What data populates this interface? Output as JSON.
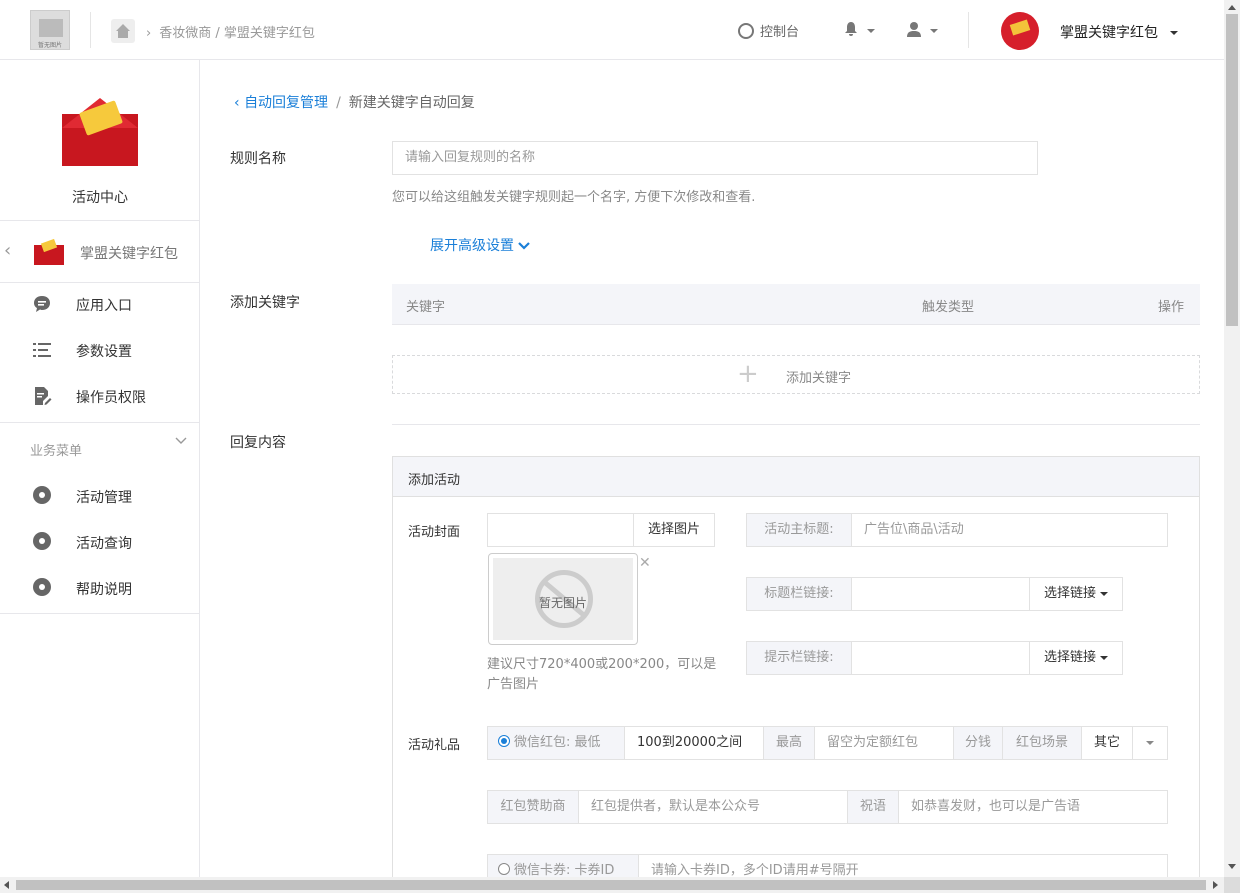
{
  "topbar": {
    "logo_caption": "暂无图片",
    "breadcrumb": "香妆微商 / 掌盟关键字红包",
    "console_label": "控制台",
    "account_title": "掌盟关键字红包"
  },
  "sidebar": {
    "center_label": "活动中心",
    "app_name": "掌盟关键字红包",
    "items": [
      {
        "label": "应用入口",
        "icon": "chat-icon"
      },
      {
        "label": "参数设置",
        "icon": "list-icon"
      },
      {
        "label": "操作员权限",
        "icon": "document-edit-icon"
      }
    ],
    "group_label": "业务菜单",
    "business_items": [
      {
        "label": "活动管理",
        "icon": "gear-icon"
      },
      {
        "label": "活动查询",
        "icon": "gear-icon"
      },
      {
        "label": "帮助说明",
        "icon": "gear-icon"
      }
    ]
  },
  "main": {
    "breadcrumb": {
      "parent": "自动回复管理",
      "sep": "/",
      "current": "新建关键字自动回复"
    },
    "rule_name": {
      "label": "规则名称",
      "placeholder": "请输入回复规则的名称",
      "hint": "您可以给这组触发关键字规则起一个名字, 方便下次修改和查看."
    },
    "advanced_toggle": "展开高级设置",
    "keywords": {
      "label": "添加关键字",
      "columns": [
        "关键字",
        "触发类型",
        "操作"
      ],
      "add_label": "添加关键字"
    },
    "reply": {
      "label": "回复内容",
      "panel_title": "添加活动",
      "cover_label": "活动封面",
      "select_image": "选择图片",
      "no_image": "暂无图片",
      "cover_hint": "建议尺寸720*400或200*200，可以是广告图片",
      "main_title_label": "活动主标题:",
      "main_title_placeholder": "广告位\\商品\\活动",
      "title_link_label": "标题栏链接:",
      "tip_link_label": "提示栏链接:",
      "select_link": "选择链接",
      "gift_label": "活动礼品",
      "wechat_redpack": "微信红包: 最低",
      "min_value": "100到20000之间",
      "max_label": "最高",
      "max_placeholder": "留空为定额红包",
      "unit": "分钱",
      "scene_label": "红包场景",
      "scene_value": "其它",
      "sponsor_label": "红包赞助商",
      "sponsor_placeholder": "红包提供者，默认是本公众号",
      "wish_label": "祝语",
      "wish_placeholder": "如恭喜发财，也可以是广告语",
      "card_label": "微信卡券: 卡券ID",
      "card_placeholder": "请输入卡券ID，多个ID请用#号隔开"
    }
  }
}
